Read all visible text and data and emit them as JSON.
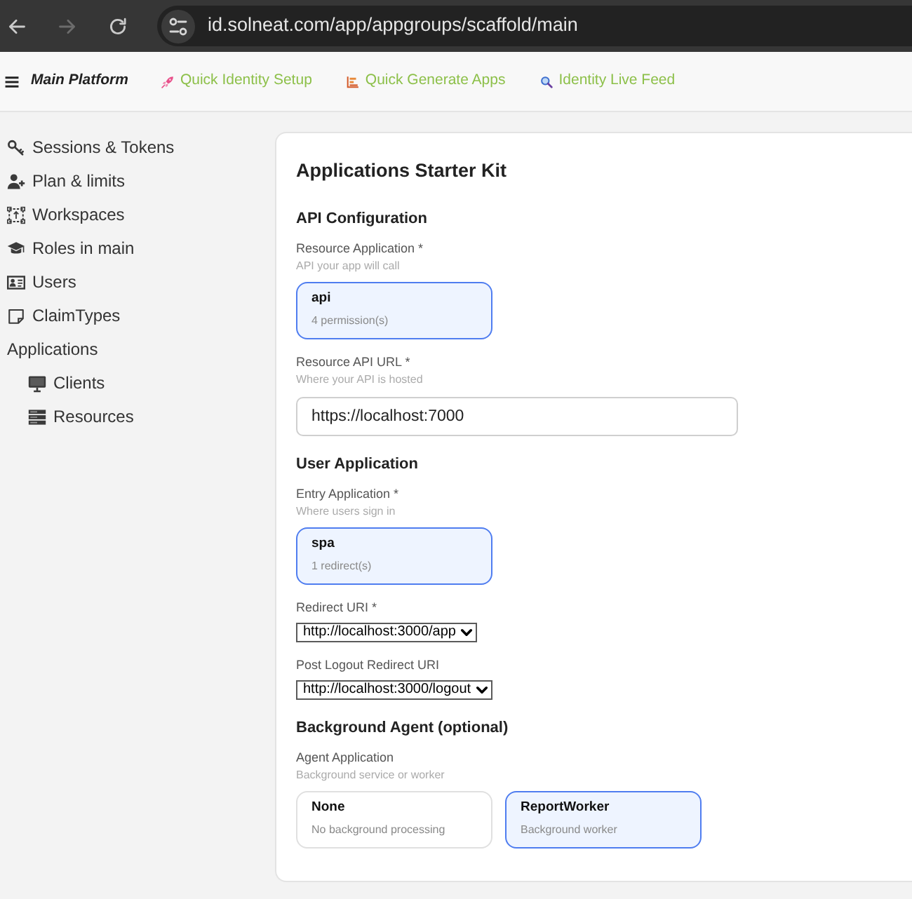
{
  "browser": {
    "url": "id.solneat.com/app/appgroups/scaffold/main",
    "forward_disabled": true
  },
  "header": {
    "title": "Main Platform",
    "links": [
      {
        "label": "Quick Identity Setup"
      },
      {
        "label": "Quick Generate Apps"
      },
      {
        "label": "Identity Live Feed"
      }
    ]
  },
  "sidebar": {
    "items": [
      {
        "label": "Sessions & Tokens"
      },
      {
        "label": "Plan & limits"
      },
      {
        "label": "Workspaces"
      },
      {
        "label": "Roles in main"
      },
      {
        "label": "Users"
      },
      {
        "label": "ClaimTypes"
      },
      {
        "label": "Applications",
        "children": [
          {
            "label": "Clients"
          },
          {
            "label": "Resources"
          }
        ]
      }
    ]
  },
  "card": {
    "title": "Applications Starter Kit",
    "sections": [
      {
        "heading": "API Configuration",
        "fields": [
          {
            "kind": "options",
            "label": "Resource Application *",
            "hint": "API your app will call",
            "options": [
              {
                "title": "api",
                "subtitle": "4 permission(s)",
                "selected": true
              }
            ]
          },
          {
            "kind": "text",
            "label": "Resource API URL *",
            "hint": "Where your API is hosted",
            "value": "https://localhost:7000"
          }
        ]
      },
      {
        "heading": "User Application",
        "fields": [
          {
            "kind": "options",
            "label": "Entry Application *",
            "hint": "Where users sign in",
            "options": [
              {
                "title": "spa",
                "subtitle": "1 redirect(s)",
                "selected": true
              }
            ]
          },
          {
            "kind": "select",
            "label": "Redirect URI *",
            "value": "http://localhost:3000/app"
          },
          {
            "kind": "select",
            "label": "Post Logout Redirect URI",
            "value": "http://localhost:3000/logout"
          }
        ]
      },
      {
        "heading": "Background Agent (optional)",
        "fields": [
          {
            "kind": "options",
            "label": "Agent Application",
            "hint": "Background service or worker",
            "options": [
              {
                "title": "None",
                "subtitle": "No background processing",
                "selected": false
              },
              {
                "title": "ReportWorker",
                "subtitle": "Background worker",
                "selected": true
              }
            ]
          }
        ]
      }
    ]
  }
}
